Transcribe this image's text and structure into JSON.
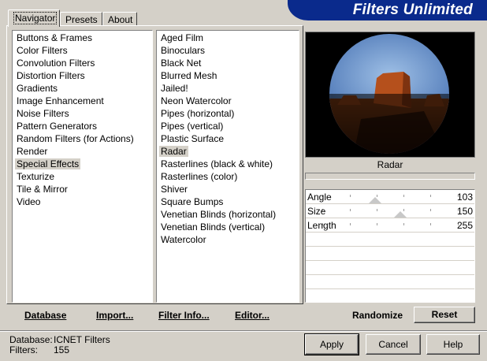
{
  "tabs": [
    {
      "label": "Navigator",
      "active": true
    },
    {
      "label": "Presets",
      "active": false
    },
    {
      "label": "About",
      "active": false
    }
  ],
  "banner": {
    "title": "Filters Unlimited"
  },
  "categories": [
    {
      "label": "Buttons & Frames"
    },
    {
      "label": "Color Filters"
    },
    {
      "label": "Convolution Filters"
    },
    {
      "label": "Distortion Filters"
    },
    {
      "label": "Gradients"
    },
    {
      "label": "Image Enhancement"
    },
    {
      "label": "Noise Filters"
    },
    {
      "label": "Pattern Generators"
    },
    {
      "label": "Random Filters (for Actions)"
    },
    {
      "label": "Render"
    },
    {
      "label": "Special Effects",
      "selected": true
    },
    {
      "label": "Texturize"
    },
    {
      "label": "Tile & Mirror"
    },
    {
      "label": "Video"
    }
  ],
  "filters": [
    {
      "label": "Aged Film"
    },
    {
      "label": "Binoculars"
    },
    {
      "label": "Black Net"
    },
    {
      "label": "Blurred Mesh"
    },
    {
      "label": "Jailed!"
    },
    {
      "label": "Neon Watercolor"
    },
    {
      "label": "Pipes (horizontal)"
    },
    {
      "label": "Pipes (vertical)"
    },
    {
      "label": "Plastic Surface"
    },
    {
      "label": "Radar",
      "selected": true
    },
    {
      "label": "Rasterlines (black & white)"
    },
    {
      "label": "Rasterlines (color)"
    },
    {
      "label": "Shiver"
    },
    {
      "label": "Square Bumps"
    },
    {
      "label": "Venetian Blinds (horizontal)"
    },
    {
      "label": "Venetian Blinds (vertical)"
    },
    {
      "label": "Watercolor"
    }
  ],
  "preview": {
    "label": "Radar"
  },
  "params": [
    {
      "label": "Angle",
      "value": "103",
      "level": 0.4
    },
    {
      "label": "Size",
      "value": "150",
      "level": 0.59
    },
    {
      "label": "Length",
      "value": "255",
      "level": 1.0
    }
  ],
  "toolbar": {
    "database": "Database",
    "import": "Import...",
    "filter_info": "Filter Info...",
    "editor": "Editor...",
    "randomize": "Randomize",
    "reset": "Reset"
  },
  "status": {
    "database_label": "Database:",
    "database_value": "ICNET Filters",
    "filters_label": "Filters:",
    "filters_value": "155"
  },
  "buttons": {
    "apply": "Apply",
    "cancel": "Cancel",
    "help": "Help"
  },
  "colors": {
    "banner": "#0a2a8c",
    "dialog": "#d4d0c8",
    "selection": "#d4d0c8"
  }
}
